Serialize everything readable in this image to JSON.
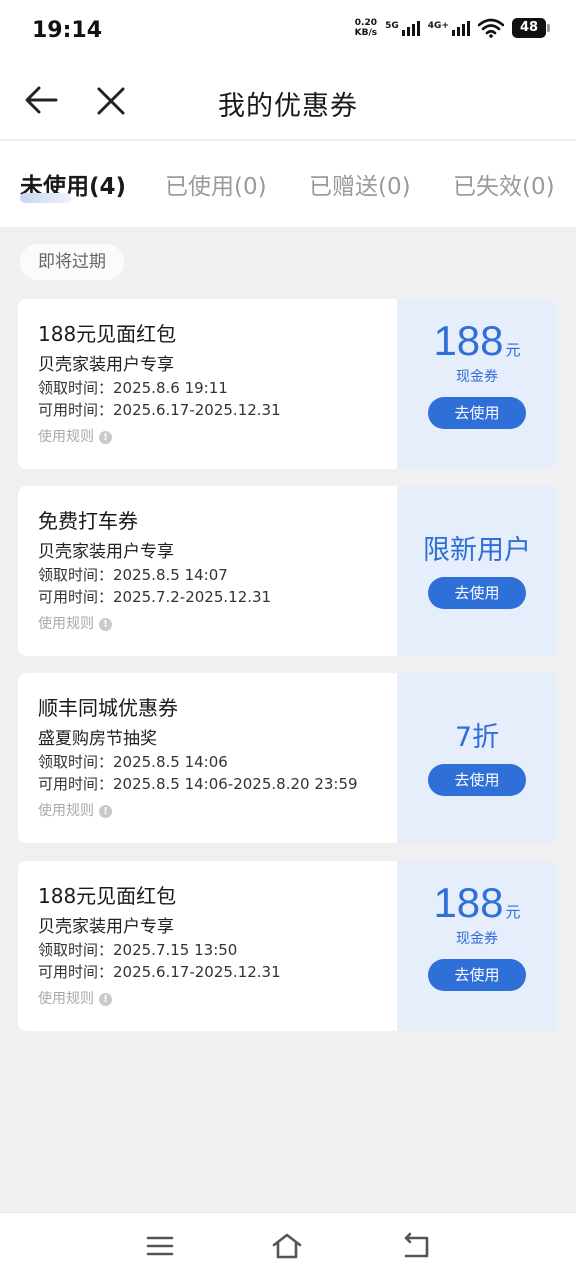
{
  "status_bar": {
    "time": "19:14",
    "net_speed_value": "0.20",
    "net_speed_unit": "KB/s",
    "signal1_label": "5G",
    "signal2_label": "4G+",
    "battery": "48",
    "icons": [
      "signal-5g-icon",
      "signal-4g-icon",
      "wifi-icon",
      "battery-icon"
    ]
  },
  "navbar": {
    "title": "我的优惠券",
    "back_icon": "arrow-left-icon",
    "close_icon": "close-icon"
  },
  "tabs": [
    {
      "label": "未使用(4)",
      "active": true
    },
    {
      "label": "已使用(0)",
      "active": false
    },
    {
      "label": "已赠送(0)",
      "active": false
    },
    {
      "label": "已失效(0)",
      "active": false
    }
  ],
  "section_label": "即将过期",
  "coupons": [
    {
      "title": "188元见面红包",
      "subtitle": "贝壳家装用户专享",
      "received": "领取时间：2025.8.6 19:11",
      "valid": "可用时间：2025.6.17-2025.12.31",
      "rules": "使用规则",
      "amount": "188",
      "unit": "元",
      "type": "现金券",
      "button": "去使用"
    },
    {
      "title": "免费打车券",
      "subtitle": "贝壳家装用户专享",
      "received": "领取时间：2025.8.5 14:07",
      "valid": "可用时间：2025.7.2-2025.12.31",
      "rules": "使用规则",
      "value_text": "限新用户",
      "button": "去使用"
    },
    {
      "title": "顺丰同城优惠券",
      "subtitle": "盛夏购房节抽奖",
      "received": "领取时间：2025.8.5 14:06",
      "valid": "可用时间：2025.8.5 14:06-2025.8.20 23:59",
      "rules": "使用规则",
      "value_text": "7折",
      "button": "去使用"
    },
    {
      "title": "188元见面红包",
      "subtitle": "贝壳家装用户专享",
      "received": "领取时间：2025.7.15 13:50",
      "valid": "可用时间：2025.6.17-2025.12.31",
      "rules": "使用规则",
      "amount": "188",
      "unit": "元",
      "type": "现金券",
      "button": "去使用"
    }
  ],
  "system_nav": {
    "menu_icon": "menu-icon",
    "home_icon": "home-icon",
    "back_icon": "return-icon"
  },
  "colors": {
    "accent": "#2f6fd8",
    "coupon_right_bg": "#e6eefb",
    "page_bg": "#f0f0f0"
  }
}
